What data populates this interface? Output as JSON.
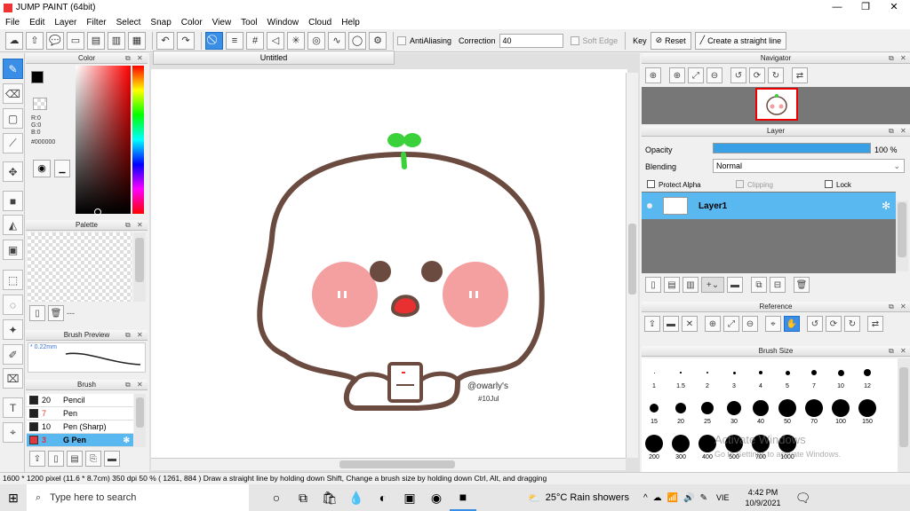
{
  "window": {
    "title": "JUMP PAINT (64bit)"
  },
  "menu": [
    "File",
    "Edit",
    "Layer",
    "Filter",
    "Select",
    "Snap",
    "Color",
    "View",
    "Tool",
    "Window",
    "Cloud",
    "Help"
  ],
  "toolbar": {
    "antialiasing_label": "AntiAliasing",
    "correction_label": "Correction",
    "correction_value": "40",
    "softedge_label": "Soft Edge",
    "key_label": "Key",
    "reset_label": "Reset",
    "straight_line_label": "Create a straight line"
  },
  "color_panel": {
    "title": "Color",
    "r": "R:0",
    "g": "G:0",
    "b": "B:0",
    "hex": "#000000"
  },
  "palette_panel": {
    "title": "Palette",
    "dash": "---"
  },
  "brush_preview": {
    "title": "Brush Preview",
    "size": "* 0.22mm"
  },
  "brush_panel": {
    "title": "Brush",
    "items": [
      {
        "num": "20",
        "name": "Pencil",
        "color": "#222222"
      },
      {
        "num": "7",
        "name": "Pen",
        "color": "#222222"
      },
      {
        "num": "10",
        "name": "Pen (Sharp)",
        "color": "#222222"
      },
      {
        "num": "3",
        "name": "G Pen",
        "color": "#e0393e"
      }
    ]
  },
  "canvas": {
    "title": "Untitled",
    "signature": "@owarly's",
    "date": "#10Jul"
  },
  "navigator": {
    "title": "Navigator"
  },
  "layer_panel": {
    "title": "Layer",
    "opacity_label": "Opacity",
    "opacity_value": "100 %",
    "opacity_fraction": 1.0,
    "blending_label": "Blending",
    "blending_value": "Normal",
    "protect_alpha": "Protect Alpha",
    "clipping": "Clipping",
    "lock": "Lock",
    "layer_name": "Layer1"
  },
  "reference": {
    "title": "Reference"
  },
  "brush_size": {
    "title": "Brush Size",
    "sizes": [
      "1",
      "1.5",
      "2",
      "3",
      "4",
      "5",
      "7",
      "10",
      "12",
      "15",
      "20",
      "25",
      "30",
      "40",
      "50",
      "70",
      "100",
      "150",
      "200",
      "300",
      "400",
      "500",
      "700",
      "1000"
    ],
    "watermark1": "Activate Windows",
    "watermark2": "Go to Settings to activate Windows."
  },
  "statusbar": {
    "text": "1600 * 1200 pixel   (11.6 * 8.7cm)   350 dpi   50 %   ( 1261, 884 )   Draw a straight line by holding down Shift, Change a brush size by holding down Ctrl, Alt, and dragging"
  },
  "taskbar": {
    "search_placeholder": "Type here to search",
    "weather": "25°C  Rain showers",
    "lang": "VIE",
    "time": "4:42 PM",
    "date": "10/9/2021"
  },
  "colors": {
    "accent": "#3a8ee6",
    "char_outline": "#6b4a40",
    "cheek": "#f4a0a0",
    "sprout": "#3ad13a"
  }
}
